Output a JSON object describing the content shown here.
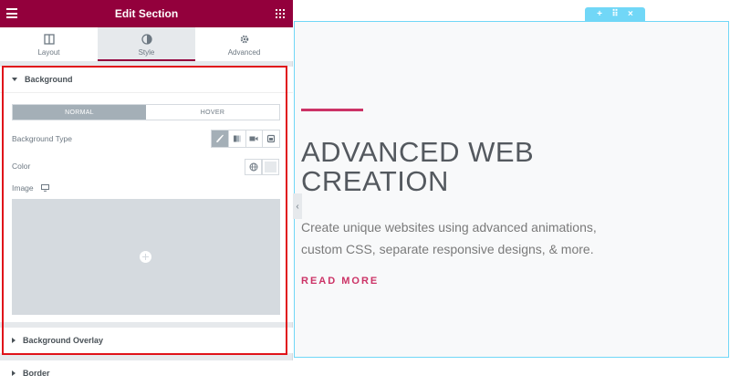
{
  "panel": {
    "title": "Edit Section",
    "tabs": [
      {
        "label": "Layout",
        "icon": "layout-icon"
      },
      {
        "label": "Style",
        "icon": "style-icon"
      },
      {
        "label": "Advanced",
        "icon": "gear-icon"
      }
    ],
    "active_tab": "Style"
  },
  "sections": {
    "background": {
      "label": "Background",
      "state_tabs": [
        "NORMAL",
        "HOVER"
      ],
      "active_state": "NORMAL",
      "type_label": "Background Type",
      "type_options": [
        "classic-brush-icon",
        "gradient-icon",
        "video-icon",
        "slideshow-icon"
      ],
      "color_label": "Color",
      "image_label": "Image"
    },
    "overlay": {
      "label": "Background Overlay"
    },
    "border": {
      "label": "Border"
    }
  },
  "preview": {
    "headline_line1": "ADVANCED WEB",
    "headline_line2": "CREATION",
    "body_line1": "Create unique websites using advanced animations,",
    "body_line2": "custom CSS, separate responsive designs, & more.",
    "cta": "READ MORE",
    "handle_icons": [
      "+",
      "⠿",
      "×"
    ],
    "collapse_icon": "‹"
  },
  "colors": {
    "brand": "#93003c",
    "accent": "#cc3366",
    "handle": "#71d7f7",
    "highlight_box": "#e0131a"
  }
}
